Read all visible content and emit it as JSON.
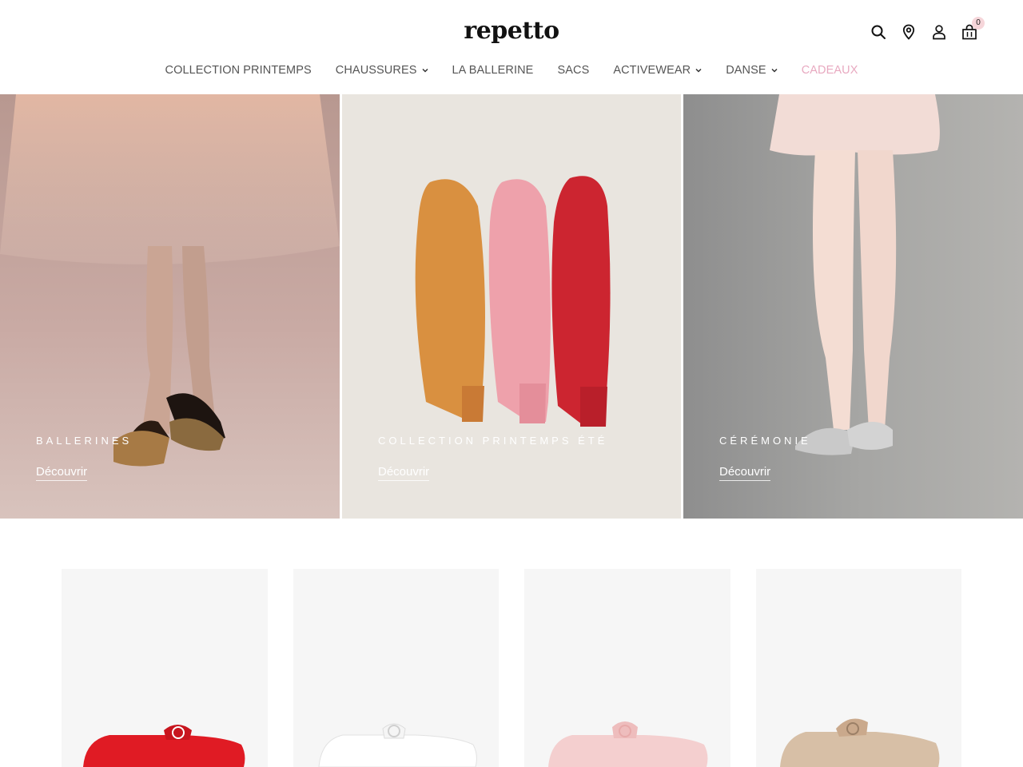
{
  "brand": {
    "logo_text": "repetto"
  },
  "header": {
    "icons": [
      "search-icon",
      "location-pin-icon",
      "account-icon",
      "cart-icon"
    ],
    "cart_count": "0"
  },
  "nav": {
    "items": [
      {
        "label": "COLLECTION PRINTEMPS",
        "has_dropdown": false
      },
      {
        "label": "CHAUSSURES",
        "has_dropdown": true
      },
      {
        "label": "LA BALLERINE",
        "has_dropdown": false
      },
      {
        "label": "SACS",
        "has_dropdown": false
      },
      {
        "label": "ACTIVEWEAR",
        "has_dropdown": true
      },
      {
        "label": "DANSE",
        "has_dropdown": true
      },
      {
        "label": "CADEAUX",
        "has_dropdown": false,
        "accent": true
      }
    ],
    "accent_color": "#e8a9c0"
  },
  "hero": {
    "tiles": [
      {
        "title": "BALLERINES",
        "cta": "Découvrir"
      },
      {
        "title": "COLLECTION PRINTEMPS ÉTÉ",
        "cta": "Découvrir"
      },
      {
        "title": "CÉRÉMONIE",
        "cta": "Découvrir"
      }
    ]
  },
  "products": {
    "colors": [
      "#e01b24",
      "#ffffff",
      "#f4cfcf",
      "#d7bfa6"
    ]
  }
}
